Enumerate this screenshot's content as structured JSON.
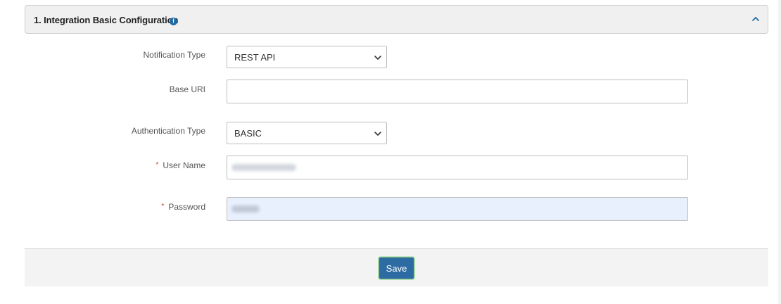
{
  "panel": {
    "title": "1. Integration Basic Configuration",
    "info_glyph": "!",
    "collapse_icon": "chevron-up-icon"
  },
  "form": {
    "notification_type": {
      "label": "Notification Type",
      "selected": "REST API"
    },
    "base_uri": {
      "label": "Base URI",
      "value": ""
    },
    "authentication_type": {
      "label": "Authentication Type",
      "selected": "BASIC"
    },
    "user_name": {
      "label": "User Name",
      "required_marker": "*",
      "value_redacted": true
    },
    "password": {
      "label": "Password",
      "required_marker": "*",
      "value_redacted": true,
      "autofilled": true
    }
  },
  "footer": {
    "save_label": "Save"
  },
  "colors": {
    "accent": "#2c6ca3",
    "info_icon": "#1f6aa5",
    "required": "#c0392b",
    "autofill_bg": "#e8f0fe"
  }
}
